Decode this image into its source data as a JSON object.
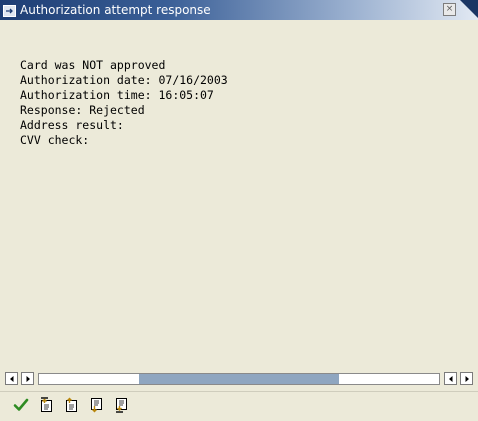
{
  "window": {
    "title": "Authorization attempt response",
    "close_glyph": "×"
  },
  "message": {
    "lines": [
      "Card was NOT approved",
      "Authorization date: 07/16/2003",
      "Authorization time: 16:05:07",
      "Response: Rejected",
      "Address result:",
      "CVV check:"
    ]
  },
  "scrollbar": {
    "position_fraction": 0.5,
    "visible_fraction": 0.5
  },
  "toolbar": {
    "buttons": [
      {
        "icon": "checkmark-icon",
        "name": "continue"
      },
      {
        "icon": "first-page-icon",
        "name": "first-page"
      },
      {
        "icon": "previous-page-icon",
        "name": "previous-page"
      },
      {
        "icon": "next-page-icon",
        "name": "next-page"
      },
      {
        "icon": "last-page-icon",
        "name": "last-page"
      }
    ]
  },
  "colors": {
    "title_bar_dark": "#1d3d73",
    "background": "#ecead9",
    "scroll_thumb": "#8fa6c0",
    "check_green": "#2e8b22"
  }
}
